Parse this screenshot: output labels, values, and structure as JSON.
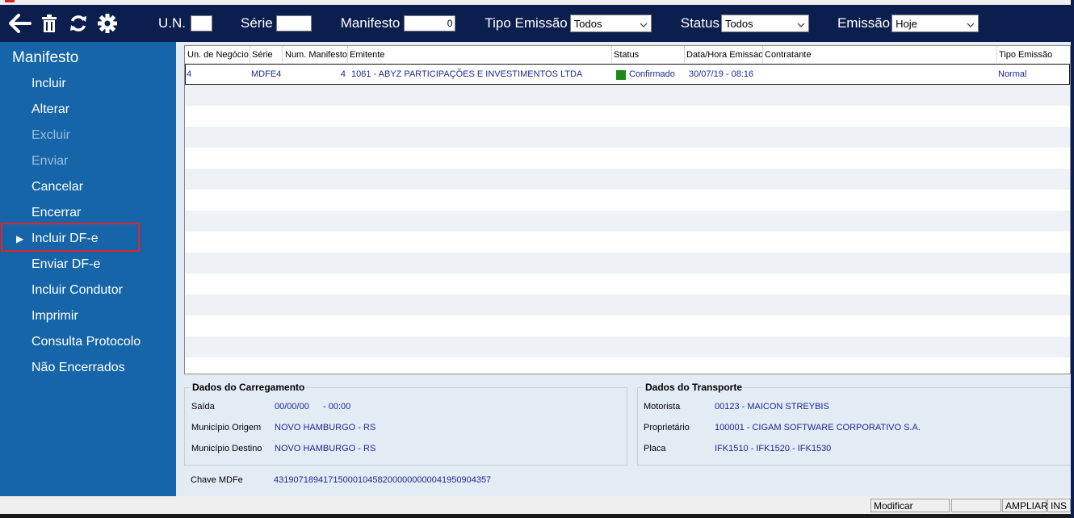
{
  "toolbar": {
    "icons": [
      "back-arrow-icon",
      "trash-icon",
      "refresh-icon",
      "gear-icon"
    ],
    "un_label": "U.N.",
    "un_value": "",
    "serie_label": "Série",
    "serie_value": "",
    "manifesto_label": "Manifesto",
    "manifesto_value": "0",
    "tipo_emissao_label": "Tipo Emissão",
    "tipo_emissao_value": "Todos",
    "status_label": "Status",
    "status_value": "Todos",
    "emissao_label": "Emissão",
    "emissao_value": "Hoje"
  },
  "sidebar": {
    "title": "Manifesto",
    "items": [
      {
        "label": "Incluir",
        "enabled": true
      },
      {
        "label": "Alterar",
        "enabled": true
      },
      {
        "label": "Excluir",
        "enabled": false
      },
      {
        "label": "Enviar",
        "enabled": false
      },
      {
        "label": "Cancelar",
        "enabled": true
      },
      {
        "label": "Encerrar",
        "enabled": true
      },
      {
        "label": "Incluir DF-e",
        "enabled": true,
        "selected": true
      },
      {
        "label": "Enviar DF-e",
        "enabled": true
      },
      {
        "label": "Incluir Condutor",
        "enabled": true
      },
      {
        "label": "Imprimir",
        "enabled": true
      },
      {
        "label": "Consulta Protocolo",
        "enabled": true
      },
      {
        "label": "Não Encerrados",
        "enabled": true
      }
    ]
  },
  "grid": {
    "columns": [
      "Un. de Negócio",
      "Série",
      "Num. Manifesto",
      "Emitente",
      "Status",
      "Data/Hora Emissao",
      "Contratante",
      "Tipo Emissão"
    ],
    "rows": [
      {
        "un": "4",
        "serie": "MDFE4",
        "num": "4",
        "emitente": "1061 - ABYZ PARTICIPAÇÕES E INVESTIMENTOS LTDA",
        "status": "Confirmado",
        "status_color": "#1b8a1b",
        "data": "30/07/19 - 08:16",
        "contratante": "",
        "tipo": "Normal"
      }
    ]
  },
  "carregamento": {
    "title": "Dados do Carregamento",
    "saida_label": "Saída",
    "saida_date": "00/00/00",
    "saida_time": "- 00:00",
    "origem_label": "Município Origem",
    "origem_value": "NOVO HAMBURGO - RS",
    "destino_label": "Município Destino",
    "destino_value": "NOVO HAMBURGO - RS"
  },
  "transporte": {
    "title": "Dados do Transporte",
    "motorista_label": "Motorista",
    "motorista_value": "00123 - MAICON STREYBIS",
    "proprietario_label": "Proprietário",
    "proprietario_value": "100001 - CIGAM SOFTWARE CORPORATIVO S.A.",
    "placa_label": "Placa",
    "placa_value": "IFK1510 - IFK1520 - IFK1530"
  },
  "chave": {
    "label": "Chave MDFe",
    "value": "43190718941715000104582000000000041950904357"
  },
  "statusbar": {
    "mode": "Modificar",
    "ampliar": "AMPLIAR",
    "ins": "INS"
  },
  "colors": {
    "toolbar_bg": "#0b1e4e",
    "sidebar_bg": "#1565a8",
    "main_bg": "#e3ebf5",
    "value_text": "#1c2a96",
    "highlight": "#e0242a"
  }
}
